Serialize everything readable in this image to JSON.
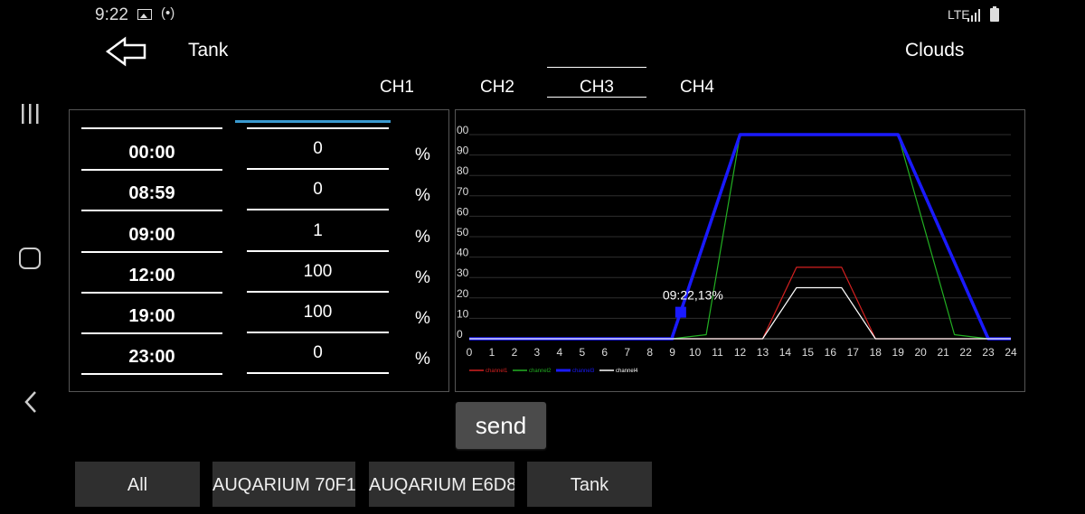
{
  "status_bar": {
    "time": "9:22",
    "network": "LTE",
    "icons": [
      "image-icon",
      "cast-icon",
      "signal-icon",
      "battery-icon"
    ]
  },
  "header": {
    "title": "Tank",
    "mode": "Clouds",
    "back_icon": "arrow-left-icon"
  },
  "tabs": [
    {
      "label": "CH1",
      "active": false
    },
    {
      "label": "CH2",
      "active": false
    },
    {
      "label": "CH3",
      "active": true
    },
    {
      "label": "CH4",
      "active": false
    }
  ],
  "schedule": {
    "unit": "%",
    "rows": [
      {
        "time": "00:00",
        "value": "0"
      },
      {
        "time": "08:59",
        "value": "0"
      },
      {
        "time": "09:00",
        "value": "1"
      },
      {
        "time": "12:00",
        "value": "100"
      },
      {
        "time": "19:00",
        "value": "100"
      },
      {
        "time": "23:00",
        "value": "0"
      }
    ]
  },
  "chart_data": {
    "type": "line",
    "xlim": [
      0,
      24
    ],
    "ylim": [
      0,
      100
    ],
    "x_ticks": [
      "0",
      "1",
      "2",
      "3",
      "4",
      "5",
      "6",
      "7",
      "8",
      "9",
      "10",
      "11",
      "12",
      "13",
      "14",
      "15",
      "16",
      "17",
      "18",
      "19",
      "20",
      "21",
      "22",
      "23",
      "24"
    ],
    "y_ticks": [
      "0",
      "10",
      "20",
      "30",
      "40",
      "50",
      "60",
      "70",
      "80",
      "90",
      "00"
    ],
    "grid": true,
    "legend_position": "bottom-left",
    "series": [
      {
        "name": "channel1",
        "color": "#d42020",
        "points": [
          [
            0,
            0
          ],
          [
            9,
            0
          ],
          [
            13,
            0
          ],
          [
            14.5,
            35
          ],
          [
            16.5,
            35
          ],
          [
            18,
            0
          ],
          [
            24,
            0
          ]
        ]
      },
      {
        "name": "channel2",
        "color": "#22b022",
        "points": [
          [
            0,
            0
          ],
          [
            9,
            0
          ],
          [
            10.5,
            2
          ],
          [
            12,
            100
          ],
          [
            19,
            100
          ],
          [
            21.5,
            2
          ],
          [
            23,
            0
          ],
          [
            24,
            0
          ]
        ]
      },
      {
        "name": "channel3",
        "color": "#1a1aff",
        "points": [
          [
            0,
            0
          ],
          [
            9,
            0
          ],
          [
            9,
            1
          ],
          [
            12,
            100
          ],
          [
            19,
            100
          ],
          [
            23,
            0
          ],
          [
            24,
            0
          ]
        ]
      },
      {
        "name": "channel4",
        "color": "#ffffff",
        "points": [
          [
            0,
            0
          ],
          [
            13,
            0
          ],
          [
            14.5,
            25
          ],
          [
            16.5,
            25
          ],
          [
            18,
            0
          ],
          [
            24,
            0
          ]
        ]
      }
    ],
    "marker": {
      "x": 9.37,
      "y": 13,
      "label": "09:22,13%",
      "color": "#1a1aff"
    }
  },
  "actions": {
    "send_label": "send"
  },
  "devices": [
    {
      "label": "All"
    },
    {
      "label": "AUQARIUM 70F1"
    },
    {
      "label": "AUQARIUM E6D8"
    },
    {
      "label": "Tank"
    }
  ]
}
